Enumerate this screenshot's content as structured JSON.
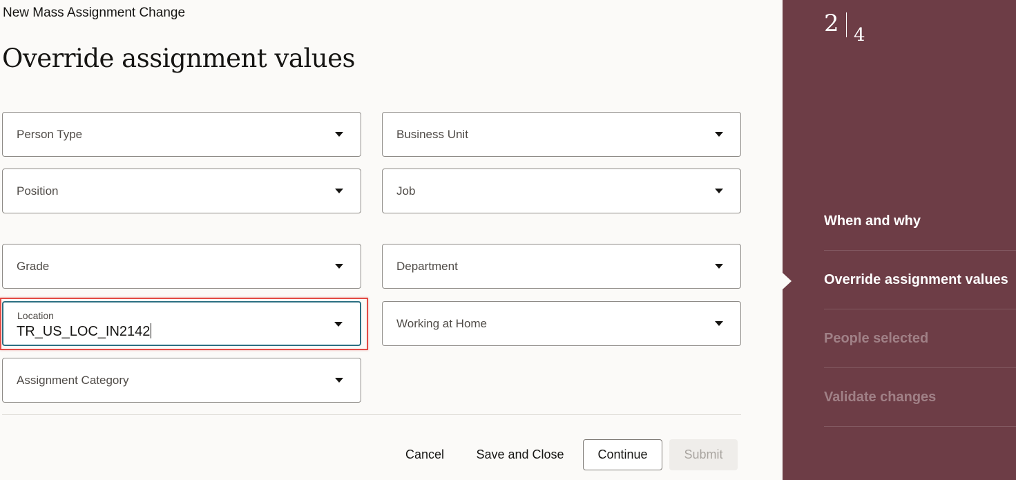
{
  "header": {
    "title": "New Mass Assignment Change"
  },
  "page": {
    "title": "Override assignment values"
  },
  "fields": {
    "person_type": {
      "label": "Person Type"
    },
    "business_unit": {
      "label": "Business Unit"
    },
    "position": {
      "label": "Position"
    },
    "job": {
      "label": "Job"
    },
    "grade": {
      "label": "Grade"
    },
    "department": {
      "label": "Department"
    },
    "location": {
      "label": "Location",
      "value": "TR_US_LOC_IN2142"
    },
    "working_at_home": {
      "label": "Working at Home"
    },
    "assignment_category": {
      "label": "Assignment Category"
    }
  },
  "actions": {
    "cancel": "Cancel",
    "save_and_close": "Save and Close",
    "continue": "Continue",
    "submit": "Submit"
  },
  "progress": {
    "current": "2",
    "total": "4",
    "steps": [
      {
        "label": "When and why",
        "state": "completed"
      },
      {
        "label": "Override assignment values",
        "state": "current"
      },
      {
        "label": "People selected",
        "state": "future"
      },
      {
        "label": "Validate changes",
        "state": "future"
      }
    ]
  },
  "colors": {
    "sidebar": "#6d3d46",
    "focus_border": "#2b6f82",
    "highlight": "#e24b45",
    "background": "#fbfaf8"
  },
  "icons": {
    "dropdown": "chevron-down-icon"
  }
}
